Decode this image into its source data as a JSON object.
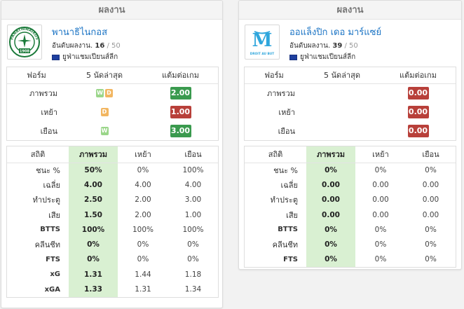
{
  "colors": {
    "win": "#9bd68a",
    "draw": "#f2b661",
    "ppg_good": "#3a9a4e",
    "ppg_bad": "#b8403a",
    "highlight": "#d9f0d2",
    "team_link": "#1a73c4"
  },
  "left": {
    "header": "ผลงาน",
    "team": {
      "name": "พานาธิไนกอส",
      "rank_label": "อันดับผลงาน.",
      "rank": "16",
      "rank_of": "/ 50",
      "league": "ยูฟ่าแชมเปียนส์ลีก",
      "logo_icon": "panathinaikos-crest-icon",
      "logo_text": "PANATHINAIKOS",
      "logo_year": "1908"
    },
    "form": {
      "headers": [
        "ฟอร์ม",
        "5 นัดล่าสุด",
        "แต้มต่อเกม"
      ],
      "rows": [
        {
          "label": "ภาพรวม",
          "results": [
            "W",
            "D"
          ],
          "ppg": "2.00",
          "ppg_color": "green"
        },
        {
          "label": "เหย้า",
          "results": [
            "D"
          ],
          "ppg": "1.00",
          "ppg_color": "red"
        },
        {
          "label": "เยือน",
          "results": [
            "W"
          ],
          "ppg": "3.00",
          "ppg_color": "green"
        }
      ]
    },
    "stats": {
      "headers": [
        "สถิติ",
        "ภาพรวม",
        "เหย้า",
        "เยือน"
      ],
      "rows": [
        {
          "label": "ชนะ %",
          "overall": "50%",
          "home": "0%",
          "away": "100%"
        },
        {
          "label": "เฉลี่ย",
          "overall": "4.00",
          "home": "4.00",
          "away": "4.00"
        },
        {
          "label": "ทำประตู",
          "overall": "2.50",
          "home": "2.00",
          "away": "3.00"
        },
        {
          "label": "เสีย",
          "overall": "1.50",
          "home": "2.00",
          "away": "1.00"
        },
        {
          "label": "BTTS",
          "overall": "100%",
          "home": "100%",
          "away": "100%"
        },
        {
          "label": "คลีนชีท",
          "overall": "0%",
          "home": "0%",
          "away": "0%"
        },
        {
          "label": "FTS",
          "overall": "0%",
          "home": "0%",
          "away": "0%"
        },
        {
          "label": "xG",
          "overall": "1.31",
          "home": "1.44",
          "away": "1.18"
        },
        {
          "label": "xGA",
          "overall": "1.33",
          "home": "1.31",
          "away": "1.34"
        }
      ]
    }
  },
  "right": {
    "header": "ผลงาน",
    "team": {
      "name": "ออแล็งปิก เดอ มาร์แซย์",
      "rank_label": "อันดับผลงาน.",
      "rank": "39",
      "rank_of": "/ 50",
      "league": "ยูฟ่าแชมเปียนส์ลีก",
      "logo_icon": "marseille-crest-icon",
      "logo_text": "DROIT AU BUT"
    },
    "form": {
      "headers": [
        "ฟอร์ม",
        "5 นัดล่าสุด",
        "แต้มต่อเกม"
      ],
      "rows": [
        {
          "label": "ภาพรวม",
          "results": [],
          "ppg": "0.00",
          "ppg_color": "red"
        },
        {
          "label": "เหย้า",
          "results": [],
          "ppg": "0.00",
          "ppg_color": "red"
        },
        {
          "label": "เยือน",
          "results": [],
          "ppg": "0.00",
          "ppg_color": "red"
        }
      ]
    },
    "stats": {
      "headers": [
        "สถิติ",
        "ภาพรวม",
        "เหย้า",
        "เยือน"
      ],
      "rows": [
        {
          "label": "ชนะ %",
          "overall": "0%",
          "home": "0%",
          "away": "0%"
        },
        {
          "label": "เฉลี่ย",
          "overall": "0.00",
          "home": "0.00",
          "away": "0.00"
        },
        {
          "label": "ทำประตู",
          "overall": "0.00",
          "home": "0.00",
          "away": "0.00"
        },
        {
          "label": "เสีย",
          "overall": "0.00",
          "home": "0.00",
          "away": "0.00"
        },
        {
          "label": "BTTS",
          "overall": "0%",
          "home": "0%",
          "away": "0%"
        },
        {
          "label": "คลีนชีท",
          "overall": "0%",
          "home": "0%",
          "away": "0%"
        },
        {
          "label": "FTS",
          "overall": "0%",
          "home": "0%",
          "away": "0%"
        }
      ]
    }
  }
}
